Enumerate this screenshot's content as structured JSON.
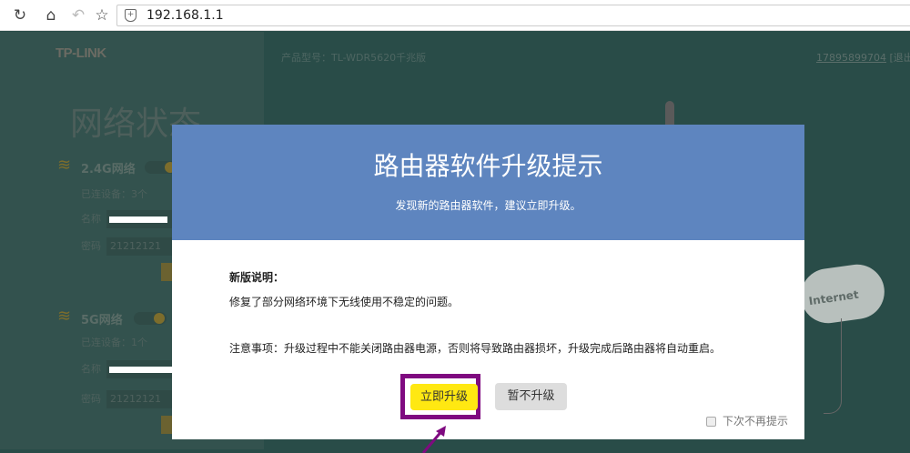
{
  "browser": {
    "url": "192.168.1.1"
  },
  "header": {
    "logo": "TP-LINK",
    "model": "产品型号：TL-WDR5620千兆版",
    "account": "17895899704",
    "logout": "[退出]"
  },
  "sidebar": {
    "title": "网络状态",
    "networks": [
      {
        "name": "2.4G网络",
        "devices": "已连设备：3个",
        "name_label": "名称",
        "pwd_label": "密码",
        "password": "21212121"
      },
      {
        "name": "5G网络",
        "devices": "已连设备：1个",
        "name_label": "名称",
        "pwd_label": "密码",
        "password": "21212121"
      }
    ]
  },
  "diagram": {
    "internet": "Internet"
  },
  "modal": {
    "title": "路由器软件升级提示",
    "subtitle": "发现新的路由器软件，建议立即升级。",
    "notes_heading": "新版说明：",
    "notes": "修复了部分网络环境下无线使用不稳定的问题。",
    "warning": "注意事项：升级过程中不能关闭路由器电源，否则将导致路由器损坏，升级完成后路由器将自动重启。",
    "upgrade_now": "立即升级",
    "skip": "暂不升级",
    "dont_remind": "下次不再提示"
  },
  "colors": {
    "modal_header": "#5e85bf",
    "primary_button": "#ffe812",
    "highlight": "#7f0a80",
    "background": "#294c48"
  }
}
